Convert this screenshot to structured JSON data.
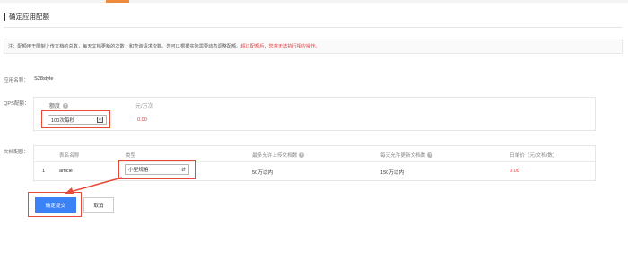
{
  "header": {
    "title": "确定应用配额"
  },
  "notice": {
    "text": "注：配额用于限制上传文档的总数，每天文档更新的次数，和查询请求次数。您可以根据实际需要动态调整配额。",
    "warning": "超过配额后，您将无法执行相应操作。"
  },
  "app": {
    "name_label": "应用名称：",
    "name_value": "S28style"
  },
  "qps": {
    "section_label": "QPS配额：",
    "quota_header": "额度",
    "unit_header": "元/万次",
    "selected": "100次每秒",
    "price": "0.00"
  },
  "doc_quota": {
    "section_label": "文档配额：",
    "columns": [
      "",
      "表名名称",
      "类型",
      "最多允许上传文档数",
      "每天允许更新文档数",
      "日单价（元/文档/数）"
    ],
    "rows": [
      {
        "index": "1",
        "name": "article",
        "type": "小型规格",
        "max_docs": "50万以内",
        "daily_updates": "150万以内",
        "price": "0.00"
      }
    ]
  },
  "actions": {
    "confirm_label": "确定提交",
    "cancel_label": "取消"
  },
  "colors": {
    "accent_blue": "#3b82f6",
    "warning_red": "#e4393c",
    "highlight_red": "#e84a3a",
    "tab_orange": "#f08a3c"
  },
  "icons": {
    "help": "help-circle-icon",
    "dropdown": "chevron-down-icon",
    "annotation": "red-arrow-icon"
  }
}
